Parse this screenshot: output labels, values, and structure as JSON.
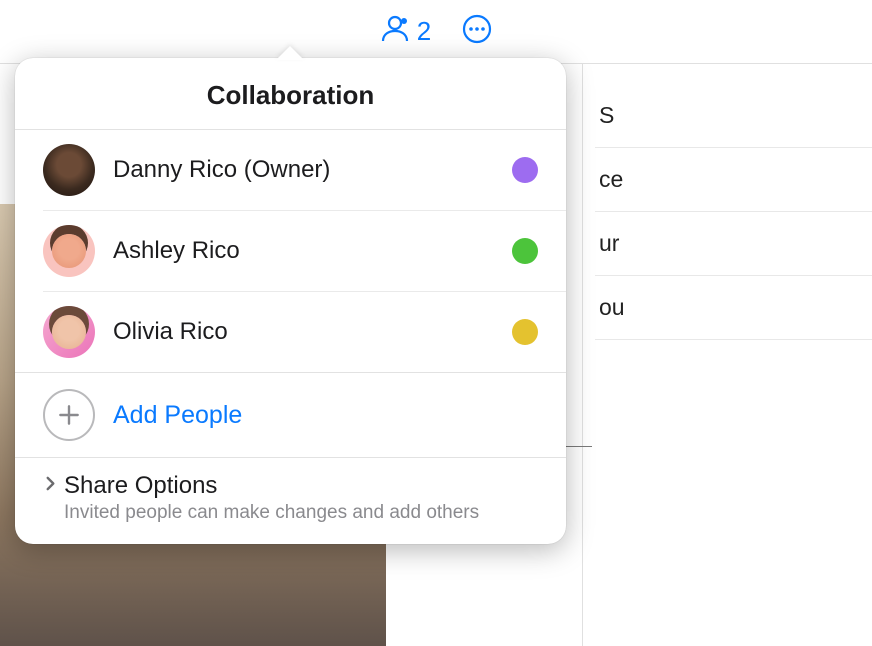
{
  "toolbar": {
    "people_count": "2"
  },
  "popover": {
    "title": "Collaboration",
    "participants": [
      {
        "name": "Danny Rico (Owner)",
        "color": "#9d6cf0"
      },
      {
        "name": "Ashley Rico",
        "color": "#4cc43b"
      },
      {
        "name": "Olivia Rico",
        "color": "#e4c22f"
      }
    ],
    "add_people_label": "Add People",
    "share_options": {
      "title": "Share Options",
      "subtitle": "Invited people can make changes and add others"
    }
  },
  "sidebar": {
    "rows": [
      "S",
      "ce",
      "ur",
      "ou"
    ]
  }
}
